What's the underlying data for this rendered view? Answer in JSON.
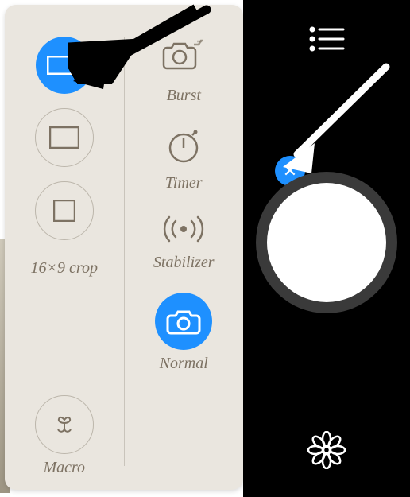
{
  "panel": {
    "col1": {
      "opt1_selected": true,
      "crop_label": "16×9 crop",
      "macro_label": "Macro"
    },
    "col2": {
      "burst_label": "Burst",
      "timer_label": "Timer",
      "stabilizer_label": "Stabilizer",
      "normal_label": "Normal",
      "normal_selected": true
    }
  },
  "right": {
    "close_glyph": "✕"
  }
}
